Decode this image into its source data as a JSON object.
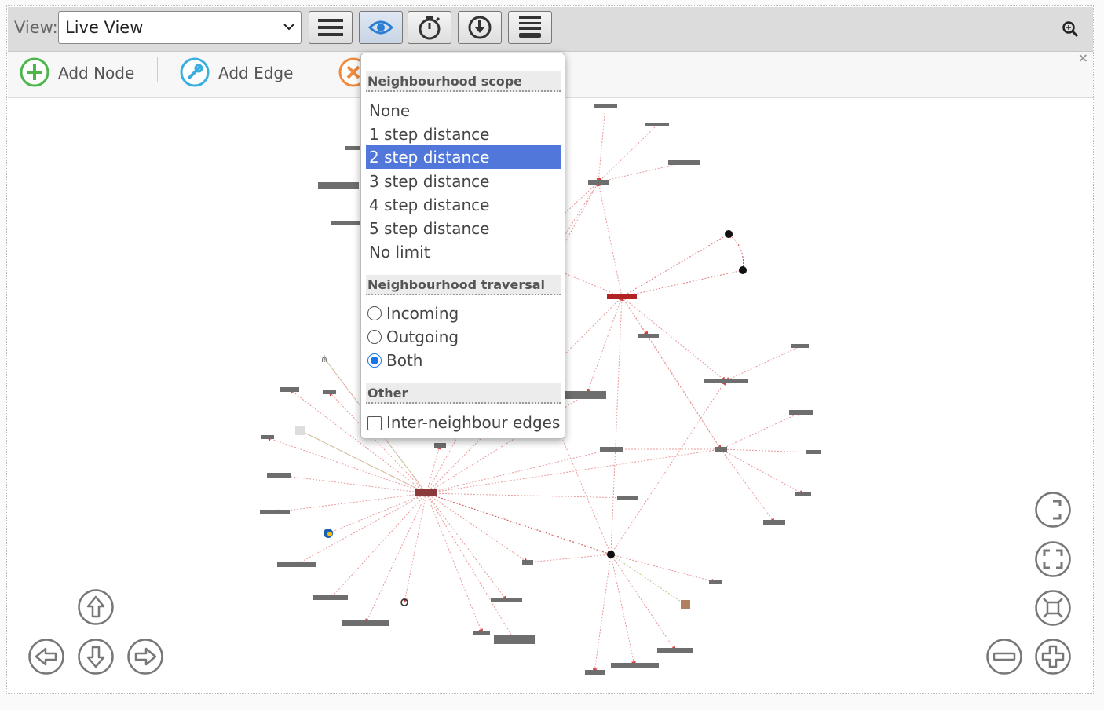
{
  "toolbar": {
    "view_label": "View:",
    "view_value": "Live View",
    "buttons": [
      {
        "name": "menu-lines-icon"
      },
      {
        "name": "eye-icon",
        "active": true
      },
      {
        "name": "stopwatch-icon"
      },
      {
        "name": "download-circle-icon"
      },
      {
        "name": "stack-icon"
      }
    ],
    "search_icon": "magnifier-icon"
  },
  "subbar": {
    "items": [
      {
        "label": "Add Node",
        "icon": "add-circle-icon",
        "color": "#4cb648"
      },
      {
        "label": "Add Edge",
        "icon": "link-circle-icon",
        "color": "#3aaee0"
      },
      {
        "label": "",
        "icon": "remove-circle-icon",
        "color": "#f08a3c"
      }
    ],
    "close": "×"
  },
  "dropdown": {
    "scope_header": "Neighbourhood scope",
    "scope_options": [
      "None",
      "1 step distance",
      "2 step distance",
      "3 step distance",
      "4 step distance",
      "5 step distance",
      "No limit"
    ],
    "scope_selected": "2 step distance",
    "traversal_header": "Neighbourhood traversal",
    "traversal_options": [
      "Incoming",
      "Outgoing",
      "Both"
    ],
    "traversal_selected": "Both",
    "other_header": "Other",
    "other_checkbox": "Inter-neighbour edges",
    "other_checked": false
  },
  "colors": {
    "edge": "#e08080",
    "node": "#666666",
    "highlight_node": "#b22222",
    "selected_option": "#5077d9"
  }
}
